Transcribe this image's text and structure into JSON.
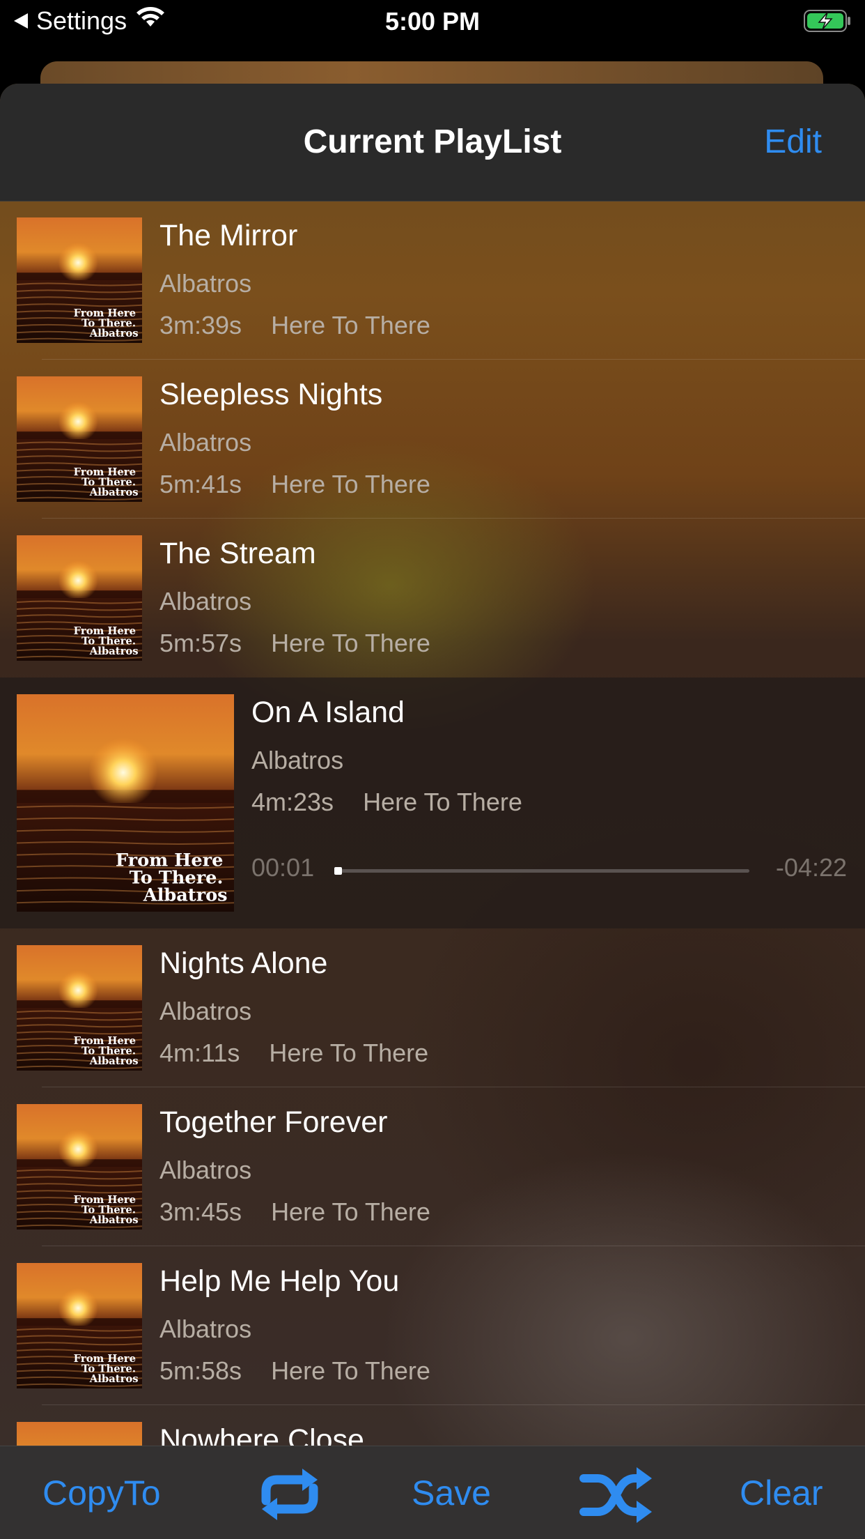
{
  "status_bar": {
    "back_label": "Settings",
    "time": "5:00 PM",
    "battery_color": "#34c759"
  },
  "nav": {
    "title": "Current PlayList",
    "edit_label": "Edit"
  },
  "tracks": [
    {
      "title": "The Mirror",
      "artist": "Albatros",
      "duration": "3m:39s",
      "album": "Here To There"
    },
    {
      "title": "Sleepless Nights",
      "artist": "Albatros",
      "duration": "5m:41s",
      "album": "Here To There"
    },
    {
      "title": "The Stream",
      "artist": "Albatros",
      "duration": "5m:57s",
      "album": "Here To There"
    },
    {
      "title": "On A Island",
      "artist": "Albatros",
      "duration": "4m:23s",
      "album": "Here To There"
    },
    {
      "title": "Nights Alone",
      "artist": "Albatros",
      "duration": "4m:11s",
      "album": "Here To There"
    },
    {
      "title": "Together Forever",
      "artist": "Albatros",
      "duration": "3m:45s",
      "album": "Here To There"
    },
    {
      "title": "Help Me Help You",
      "artist": "Albatros",
      "duration": "5m:58s",
      "album": "Here To There"
    },
    {
      "title": "Nowhere Close",
      "artist": "",
      "duration": "",
      "album": ""
    }
  ],
  "now_playing": {
    "elapsed": "00:01",
    "remaining": "-04:22",
    "progress": 0.004
  },
  "album_art": {
    "text_line1": "From Here",
    "text_line2": "To There.",
    "text_line3": "Albatros"
  },
  "toolbar": {
    "copy_label": "CopyTo",
    "repeat_icon": "repeat-icon",
    "save_label": "Save",
    "shuffle_icon": "shuffle-icon",
    "clear_label": "Clear",
    "accent": "#2f8cf0"
  }
}
